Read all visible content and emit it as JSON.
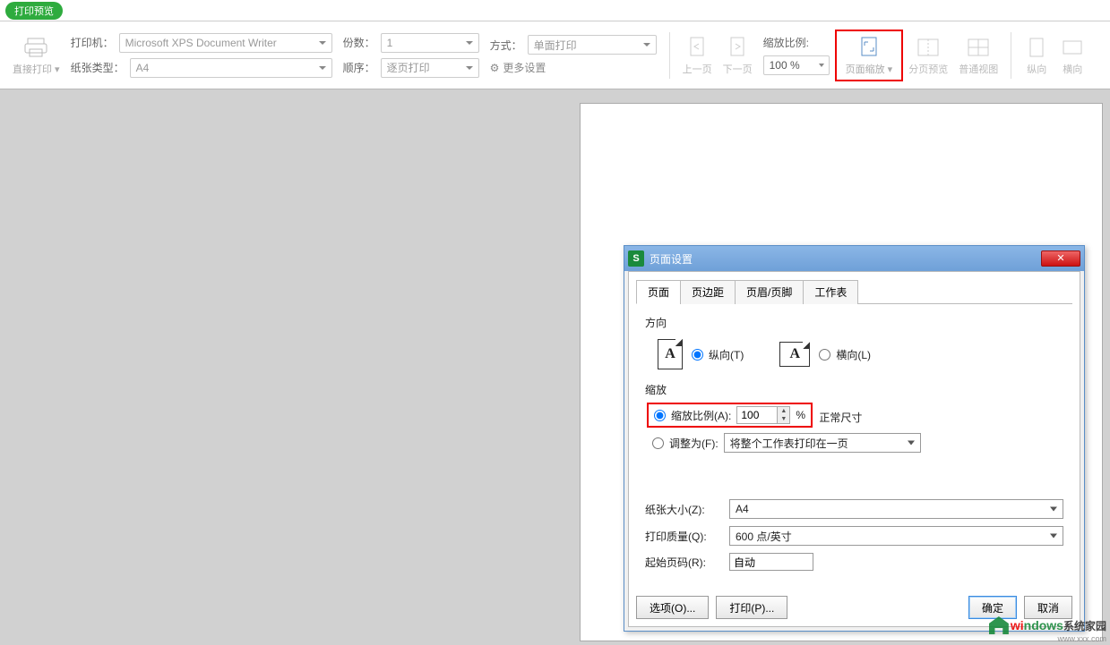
{
  "app": {
    "tab_title": "打印预览"
  },
  "ribbon": {
    "direct_print": "直接打印",
    "printer_label": "打印机：",
    "printer_value": "Microsoft XPS Document Writer",
    "paper_label": "纸张类型：",
    "paper_value": "A4",
    "copies_label": "份数：",
    "copies_value": "1",
    "order_label": "顺序：",
    "order_value": "逐页打印",
    "mode_label": "方式：",
    "mode_value": "单面打印",
    "more_settings": "更多设置",
    "prev_page": "上一页",
    "next_page": "下一页",
    "zoom_label": "缩放比例:",
    "zoom_value": "100 %",
    "page_scale": "页面缩放",
    "page_break_preview": "分页预览",
    "normal_view": "普通视图",
    "portrait": "纵向",
    "landscape": "横向"
  },
  "dialog": {
    "title": "页面设置",
    "tabs": {
      "page": "页面",
      "margins": "页边距",
      "header_footer": "页眉/页脚",
      "sheet": "工作表"
    },
    "orientation_label": "方向",
    "orient_portrait": "纵向(T)",
    "orient_landscape": "横向(L)",
    "orient_glyph": "A",
    "scale_label": "缩放",
    "scale_ratio_label": "缩放比例(A):",
    "scale_ratio_value": "100",
    "scale_pct": "%",
    "scale_normal": "正常尺寸",
    "fit_to_label": "调整为(F):",
    "fit_to_value": "将整个工作表打印在一页",
    "paper_size_label": "纸张大小(Z):",
    "paper_size_value": "A4",
    "print_quality_label": "打印质量(Q):",
    "print_quality_value": "600 点/英寸",
    "start_page_label": "起始页码(R):",
    "start_page_value": "自动",
    "btn_options": "选项(O)...",
    "btn_print": "打印(P)...",
    "btn_ok": "确定",
    "btn_cancel": "取消",
    "close_glyph": "✕"
  },
  "watermark": {
    "brand_a": "wi",
    "brand_b": "ndows",
    "brand_c": "系统家园",
    "url": "www.xxx.com"
  }
}
